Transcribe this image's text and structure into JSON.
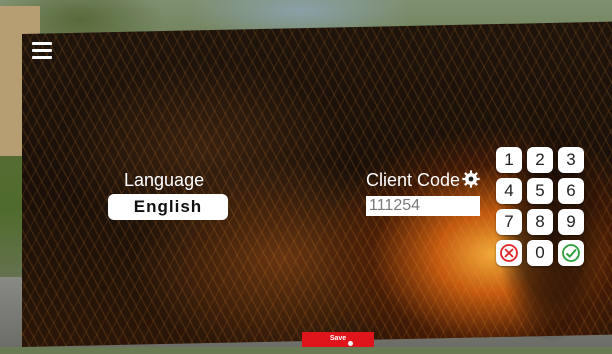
{
  "menu": {
    "icon": "hamburger-menu-icon"
  },
  "language": {
    "label": "Language",
    "value": "English"
  },
  "client_code": {
    "label": "Client Code",
    "value": "111254",
    "settings_icon": "gear-icon"
  },
  "keypad": {
    "digits": [
      "1",
      "2",
      "3",
      "4",
      "5",
      "6",
      "7",
      "8",
      "9"
    ],
    "zero": "0",
    "clear_icon": "clear-x-icon",
    "confirm_icon": "confirm-check-icon"
  },
  "footer": {
    "save_label": "Save"
  },
  "colors": {
    "save": "#e0141b",
    "clear": "#e02424",
    "confirm": "#2aa03a"
  }
}
